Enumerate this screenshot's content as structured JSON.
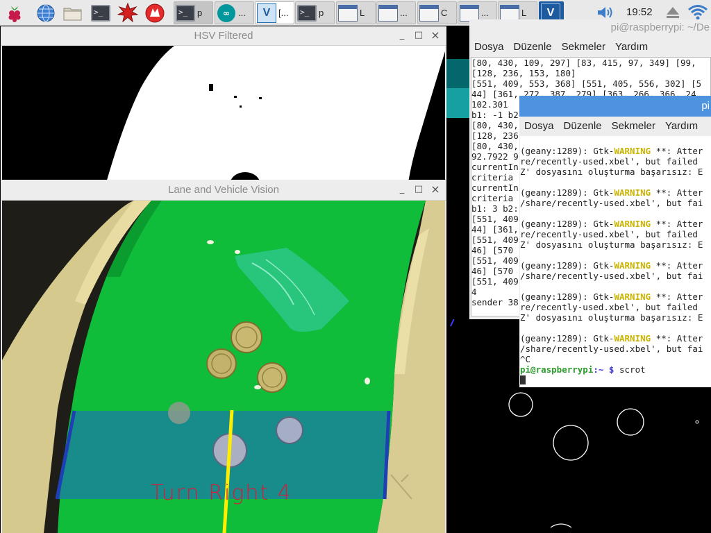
{
  "taskbar": {
    "launchers": [
      {
        "name": "raspberry-menu",
        "icon": "raspberry-icon"
      },
      {
        "name": "web-browser",
        "icon": "globe-icon"
      },
      {
        "name": "file-manager",
        "icon": "folder-icon"
      },
      {
        "name": "terminal",
        "icon": "terminal-icon"
      },
      {
        "name": "mathematica",
        "icon": "mathematica-icon"
      },
      {
        "name": "wolfram",
        "icon": "wolfram-icon"
      }
    ],
    "windows": [
      {
        "label": "p",
        "icon": "terminal-icon",
        "active": true
      },
      {
        "label": "...",
        "icon": "arduino-icon",
        "active": false
      },
      {
        "label": "[...",
        "icon": "vnc-icon",
        "active": false
      },
      {
        "label": "p",
        "icon": "terminal-icon",
        "active": false
      },
      {
        "label": "L",
        "icon": "window-icon",
        "active": false
      },
      {
        "label": "...",
        "icon": "window-icon",
        "active": false
      },
      {
        "label": "C",
        "icon": "window-icon",
        "active": false
      },
      {
        "label": "...",
        "icon": "window-icon",
        "active": false
      },
      {
        "label": "L",
        "icon": "window-icon",
        "active": false
      },
      {
        "label": "",
        "icon": "vnc-icon",
        "active": false
      }
    ],
    "clock": "19:52"
  },
  "hsv_window": {
    "title": "HSV Filtered",
    "controls": {
      "minimize": "_",
      "maximize": "□",
      "close": "×"
    }
  },
  "lane_window": {
    "title": "Lane and Vehicle Vision",
    "controls": {
      "minimize": "_",
      "maximize": "□",
      "close": "×"
    },
    "overlay_text": "Turn Right 4"
  },
  "terminal1": {
    "title": "pi@raspberrypi: ~/De",
    "menu": [
      "Dosya",
      "Düzenle",
      "Sekmeler",
      "Yardım"
    ],
    "lines": [
      "[80, 430, 109, 297] [83, 415, 97, 349] [99,",
      "[128, 236, 153, 180]",
      "[551, 409, 553, 368] [551, 405, 556, 302] [5",
      "44] [361, 272, 387, 279] [363, 266, 366, 24",
      "102.301 ",
      "b1: -1 b2",
      "[80, 430,",
      "[128, 236",
      "[80, 430,",
      "92.7922 9",
      "currentIn",
      "criteria",
      "currentIn",
      "criteria",
      "b1: 3 b2:",
      "[551, 409",
      "44] [361,",
      "[551, 409",
      "46] [570",
      "[551, 409",
      "46] [570",
      "[551, 409",
      "4",
      "sender 38"
    ]
  },
  "terminal2": {
    "title": "pi",
    "menu": [
      "Dosya",
      "Düzenle",
      "Sekmeler",
      "Yardım"
    ],
    "prompt_user": "pi@raspberrypi",
    "prompt_path": ":~ $",
    "command": "scrot",
    "interrupt": "^C",
    "warning_blocks": [
      [
        "(geany:1289): Gtk-",
        "WARNING",
        " **: Atter",
        "re/recently-used.xbel', but failed",
        "Z' dosyasını oluşturma başarısız: E"
      ],
      [
        "(geany:1289): Gtk-",
        "WARNING",
        " **: Atter",
        "/share/recently-used.xbel', but fai",
        ""
      ],
      [
        "(geany:1289): Gtk-",
        "WARNING",
        " **: Atter",
        "re/recently-used.xbel', but failed",
        "Z' dosyasını oluşturma başarısız: E"
      ],
      [
        "(geany:1289): Gtk-",
        "WARNING",
        " **: Atter",
        "/share/recently-used.xbel', but fai",
        ""
      ],
      [
        "(geany:1289): Gtk-",
        "WARNING",
        " **: Atter",
        "re/recently-used.xbel', but failed",
        "Z' dosyasını oluşturma başarısız: E"
      ],
      [
        "(geany:1289): Gtk-",
        "WARNING",
        " **: Atter",
        "/share/recently-used.xbel', but fai",
        ""
      ]
    ]
  },
  "colors": {
    "green_mat": "#0fbd3a",
    "lane_overlay": "#1a7fa0",
    "lane_line_center": "#ffee00",
    "lane_edge": "#1f3fb5",
    "overlay_text": "#d0203a",
    "terminal2_title": "#4e93dd",
    "warning": "#c9b300"
  }
}
